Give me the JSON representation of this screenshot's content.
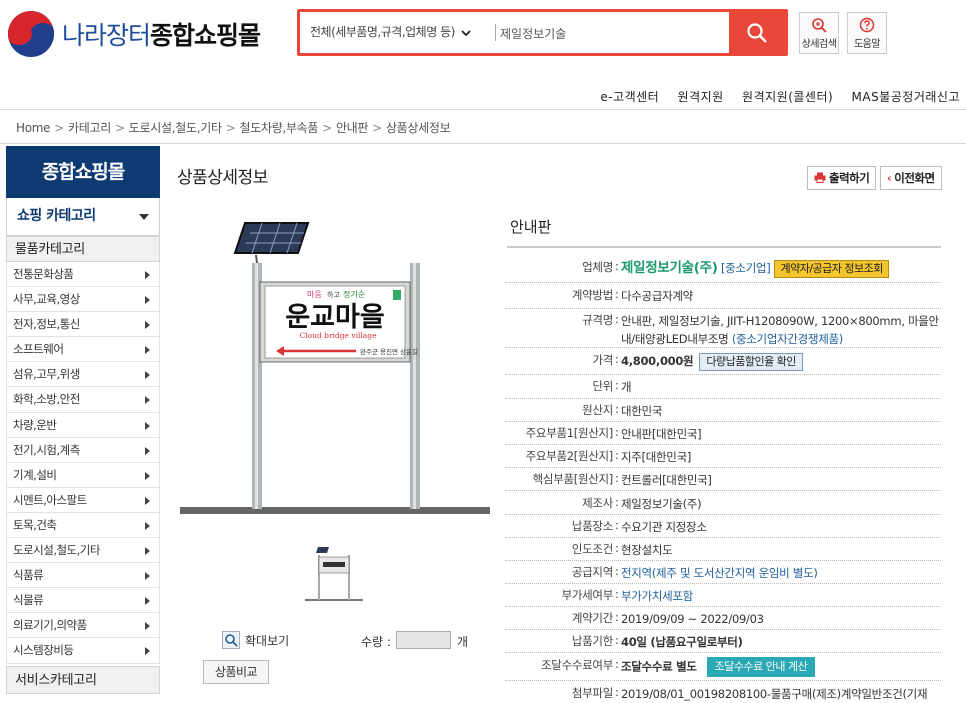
{
  "header": {
    "logo_part1": "나라장터",
    "logo_part2": "종합쇼핑몰",
    "search_scope": "전체(세부품명,규격,업체명 등)",
    "search_value": "제일정보기술",
    "detail_search_label": "상세검색",
    "help_label": "도움말"
  },
  "top_links": [
    "e-고객센터",
    "원격지원",
    "원격지원(콜센터)",
    "MAS불공정거래신고"
  ],
  "breadcrumb": [
    "Home",
    "카테고리",
    "도로시설,철도,기타",
    "철도차량,부속품",
    "안내판",
    "상품상세정보"
  ],
  "sidebar": {
    "title": "종합쇼핑몰",
    "shopping_category": "쇼핑 카테고리",
    "goods_header": "물품카테고리",
    "items": [
      "전통문화상품",
      "사무,교육,영상",
      "전자,정보,통신",
      "소프트웨어",
      "섬유,고무,위생",
      "화학,소방,안전",
      "차량,운반",
      "전기,시험,계측",
      "기계,설비",
      "시멘트,아스팔트",
      "토목,건축",
      "도로시설,철도,기타",
      "식품류",
      "식물류",
      "의료기기,의약품",
      "시스템장비등"
    ],
    "service_header": "서비스카테고리"
  },
  "page": {
    "title": "상품상세정보",
    "print_label": "출력하기",
    "prev_label": "이전화면",
    "zoom_label": "확대보기",
    "qty_label": "수량 :",
    "qty_unit": "개",
    "compare_label": "상품비교"
  },
  "sign": {
    "small_left": "마음",
    "small_mid": "하고",
    "small_right": "정기순",
    "main": "운교마을",
    "eng": "Cloud bridge village",
    "sub": "완주군 용진면 상운길"
  },
  "product": {
    "name": "안내판",
    "company_label": "업체명",
    "company": "제일정보기술(주)",
    "company_tag": "[중소기업]",
    "company_btn": "계약자/공급자 정보조회",
    "contract_method_label": "계약방법",
    "contract_method": "다수공급자계약",
    "spec_label": "규격명",
    "spec": "안내판, 제일정보기술, JIIT-H1208090W, 1200×800mm, 마을안내/태양광LED내부조명",
    "spec_tag": "(중소기업자간경쟁제품)",
    "price_label": "가격",
    "price": "4,800,000원",
    "price_btn": "다량납품할인율 확인",
    "unit_label": "단위",
    "unit": "개",
    "origin_label": "원산지",
    "origin": "대한민국",
    "part1_label": "주요부품1[원산지]",
    "part1": "안내판[대한민국]",
    "part2_label": "주요부품2[원산지]",
    "part2": "지주[대한민국]",
    "core_label": "핵심부품[원산지]",
    "core": "컨트롤러[대한민국]",
    "maker_label": "제조사",
    "maker": "제일정보기술(주)",
    "delivery_place_label": "납품장소",
    "delivery_place": "수요기관 지정장소",
    "delivery_cond_label": "인도조건",
    "delivery_cond": "현장설치도",
    "supply_area_label": "공급지역",
    "supply_area": "전지역(제주 및 도서산간지역 운임비 별도)",
    "vat_label": "부가세여부",
    "vat": "부가가치세포함",
    "period_label": "계약기간",
    "period": "2019/09/09 ~ 2022/09/03",
    "deadline_label": "납품기한",
    "deadline": "40일 (납품요구일로부터)",
    "fee_label": "조달수수료여부",
    "fee": "조달수수료 별도",
    "fee_btn": "조달수수료 안내 계산",
    "attach_label": "첨부파일",
    "attach": "2019/08/01_00198208100-물품구매(제조)계약일반조건(기재"
  }
}
